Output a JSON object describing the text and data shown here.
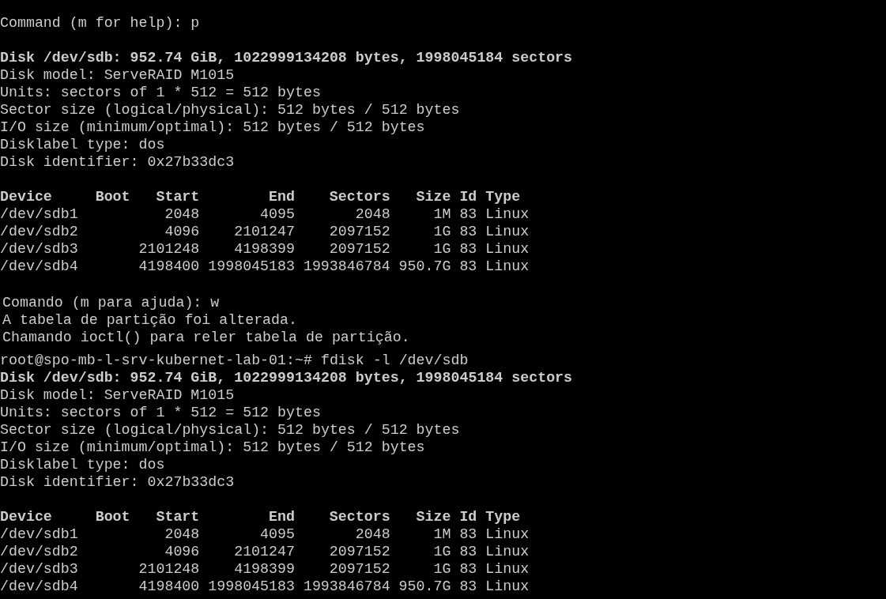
{
  "terminal": {
    "blocks": [
      {
        "kind": "line",
        "text": "Command (m for help): p"
      },
      {
        "kind": "blank"
      },
      {
        "kind": "bold",
        "text": "Disk /dev/sdb: 952.74 GiB, 1022999134208 bytes, 1998045184 sectors"
      },
      {
        "kind": "line",
        "text": "Disk model: ServeRAID M1015"
      },
      {
        "kind": "line",
        "text": "Units: sectors of 1 * 512 = 512 bytes"
      },
      {
        "kind": "line",
        "text": "Sector size (logical/physical): 512 bytes / 512 bytes"
      },
      {
        "kind": "line",
        "text": "I/O size (minimum/optimal): 512 bytes / 512 bytes"
      },
      {
        "kind": "line",
        "text": "Disklabel type: dos"
      },
      {
        "kind": "line",
        "text": "Disk identifier: 0x27b33dc3"
      },
      {
        "kind": "blank"
      },
      {
        "kind": "table",
        "columns": [
          "Device",
          "Boot",
          "Start",
          "End",
          "Sectors",
          "Size",
          "Id",
          "Type"
        ],
        "rows": [
          [
            "/dev/sdb1",
            "",
            "2048",
            "4095",
            "2048",
            "1M",
            "83",
            "Linux"
          ],
          [
            "/dev/sdb2",
            "",
            "4096",
            "2101247",
            "2097152",
            "1G",
            "83",
            "Linux"
          ],
          [
            "/dev/sdb3",
            "",
            "2101248",
            "4198399",
            "2097152",
            "1G",
            "83",
            "Linux"
          ],
          [
            "/dev/sdb4",
            "",
            "4198400",
            "1998045183",
            "1993846784",
            "950.7G",
            "83",
            "Linux"
          ]
        ]
      },
      {
        "kind": "blank"
      },
      {
        "kind": "message",
        "text": "Comando (m para ajuda): w"
      },
      {
        "kind": "message",
        "text": "A tabela de partição foi alterada."
      },
      {
        "kind": "message",
        "text": "Chamando ioctl() para reler tabela de partição."
      },
      {
        "kind": "spacer"
      },
      {
        "kind": "line",
        "text": "root@spo-mb-l-srv-kubernet-lab-01:~# fdisk -l /dev/sdb"
      },
      {
        "kind": "bold",
        "text": "Disk /dev/sdb: 952.74 GiB, 1022999134208 bytes, 1998045184 sectors"
      },
      {
        "kind": "line",
        "text": "Disk model: ServeRAID M1015"
      },
      {
        "kind": "line",
        "text": "Units: sectors of 1 * 512 = 512 bytes"
      },
      {
        "kind": "line",
        "text": "Sector size (logical/physical): 512 bytes / 512 bytes"
      },
      {
        "kind": "line",
        "text": "I/O size (minimum/optimal): 512 bytes / 512 bytes"
      },
      {
        "kind": "line",
        "text": "Disklabel type: dos"
      },
      {
        "kind": "line",
        "text": "Disk identifier: 0x27b33dc3"
      },
      {
        "kind": "blank"
      },
      {
        "kind": "table",
        "columns": [
          "Device",
          "Boot",
          "Start",
          "End",
          "Sectors",
          "Size",
          "Id",
          "Type"
        ],
        "rows": [
          [
            "/dev/sdb1",
            "",
            "2048",
            "4095",
            "2048",
            "1M",
            "83",
            "Linux"
          ],
          [
            "/dev/sdb2",
            "",
            "4096",
            "2101247",
            "2097152",
            "1G",
            "83",
            "Linux"
          ],
          [
            "/dev/sdb3",
            "",
            "2101248",
            "4198399",
            "2097152",
            "1G",
            "83",
            "Linux"
          ],
          [
            "/dev/sdb4",
            "",
            "4198400",
            "1998045183",
            "1993846784",
            "950.7G",
            "83",
            "Linux"
          ]
        ]
      }
    ]
  }
}
